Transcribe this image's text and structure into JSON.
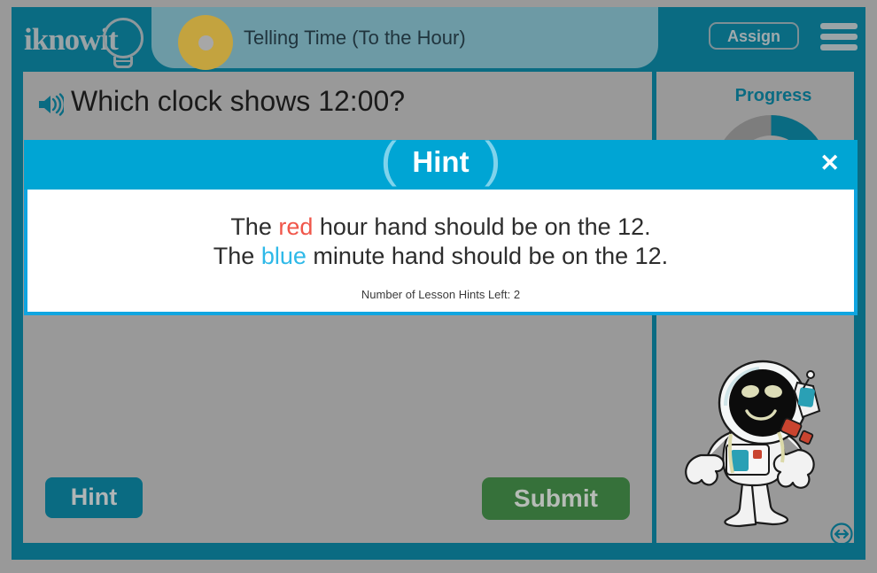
{
  "header": {
    "logo_text": "iknowit",
    "logo_icon": "lightbulb-icon",
    "lesson_title": "Telling Time (To the Hour)",
    "assign_label": "Assign",
    "menu_icon": "hamburger-menu-icon"
  },
  "question": {
    "audio_icon": "speaker-icon",
    "text": "Which clock shows 12:00?"
  },
  "progress": {
    "label": "Progress",
    "percent": 25,
    "filled_color": "#0a6b82",
    "track_color": "#7d7d7d"
  },
  "mascot": {
    "name": "astronaut-character"
  },
  "resize": {
    "icon": "resize-horizontal-icon"
  },
  "buttons": {
    "hint_label": "Hint",
    "submit_label": "Submit",
    "hint_color": "#0a6b82",
    "submit_color": "#36713a"
  },
  "hint_modal": {
    "title": "Hint",
    "close_icon": "close-icon",
    "line1_before": "The ",
    "line1_color_word": "red",
    "line1_after": " hour hand should be on the 12.",
    "line2_before": "The ",
    "line2_color_word": "blue",
    "line2_after": " minute hand should be on the 12.",
    "red_color": "#f0564a",
    "blue_color": "#2fb9e8",
    "hints_left_text": "Number of Lesson Hints Left: 2",
    "header_color": "#00a5d4"
  },
  "theme": {
    "frame_color": "#0a6b82",
    "content_bg": "#999999",
    "pill_color": "#6d9aa5",
    "dot_color": "#c3a33f"
  }
}
